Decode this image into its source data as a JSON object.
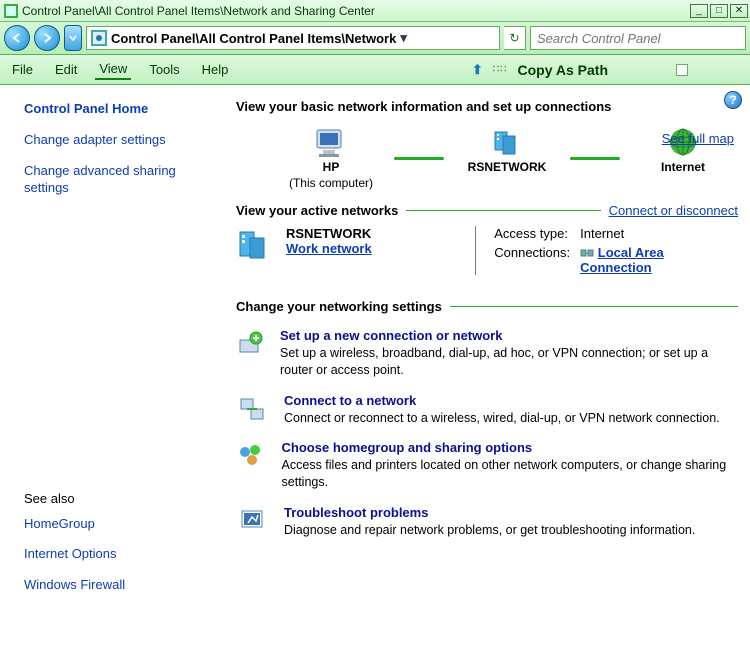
{
  "window": {
    "title": "Control Panel\\All Control Panel Items\\Network and Sharing Center"
  },
  "nav": {
    "breadcrumb": "Control Panel\\All Control Panel Items\\Network",
    "search_placeholder": "Search Control Panel"
  },
  "menu": {
    "file": "File",
    "edit": "Edit",
    "view": "View",
    "tools": "Tools",
    "help": "Help",
    "copy_as_path": "Copy As Path"
  },
  "sidebar": {
    "home": "Control Panel Home",
    "adapter": "Change adapter settings",
    "advanced": "Change advanced sharing settings",
    "see_also": "See also",
    "homegroup": "HomeGroup",
    "internet_options": "Internet Options",
    "firewall": "Windows Firewall"
  },
  "main": {
    "heading": "View your basic network information and set up connections",
    "see_full_map": "See full map",
    "map": {
      "node1": "HP",
      "node1_sub": "(This computer)",
      "node2": "RSNETWORK",
      "node3": "Internet"
    },
    "active_head": "View your active networks",
    "connect_link": "Connect or disconnect",
    "active": {
      "name": "RSNETWORK",
      "type": "Work network",
      "access_label": "Access type:",
      "access_value": "Internet",
      "conn_label": "Connections:",
      "conn_value": "Local Area Connection"
    },
    "change_head": "Change your networking settings",
    "items": [
      {
        "title": "Set up a new connection or network",
        "desc": "Set up a wireless, broadband, dial-up, ad hoc, or VPN connection; or set up a router or access point."
      },
      {
        "title": "Connect to a network",
        "desc": "Connect or reconnect to a wireless, wired, dial-up, or VPN network connection."
      },
      {
        "title": "Choose homegroup and sharing options",
        "desc": "Access files and printers located on other network computers, or change sharing settings."
      },
      {
        "title": "Troubleshoot problems",
        "desc": "Diagnose and repair network problems, or get troubleshooting information."
      }
    ]
  }
}
